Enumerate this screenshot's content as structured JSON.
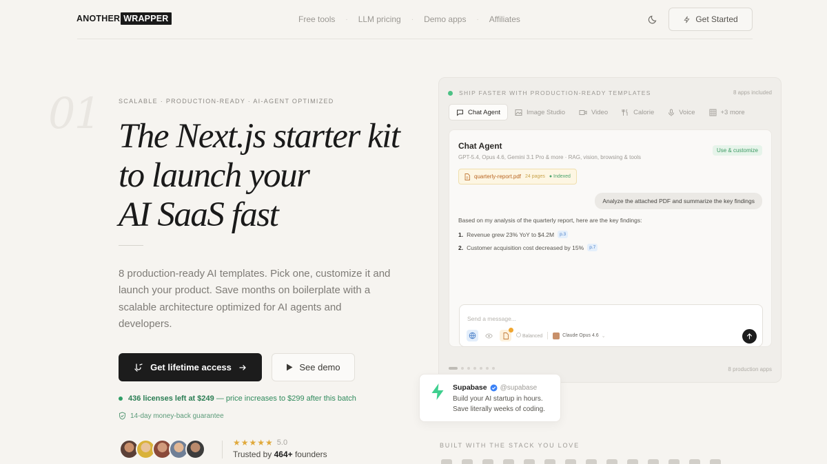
{
  "header": {
    "logo_left": "ANOTHER",
    "logo_right": "WRAPPER",
    "nav": [
      "Free tools",
      "LLM pricing",
      "Demo apps",
      "Affiliates"
    ],
    "get_started": "Get Started"
  },
  "hero": {
    "index_numeral": "01",
    "eyebrow": "SCALABLE · PRODUCTION-READY · AI-AGENT OPTIMIZED",
    "title_lines": [
      "The Next.js starter kit",
      "to launch your",
      "AI SaaS fast"
    ],
    "description": "8 production-ready AI templates. Pick one, customize it and launch your product. Save months on boilerplate with a scalable architecture optimized for AI agents and developers.",
    "primary_button": "Get lifetime access",
    "secondary_button": "See demo",
    "licenses_bold": "436 licenses left at $249",
    "licenses_rest": "— price increases to $299 after this batch",
    "guarantee": "14-day money-back guarantee",
    "stars": "★★★★★",
    "rating": "5.0",
    "trusted_prefix": "Trusted by",
    "trusted_count": "464+",
    "trusted_suffix": "founders"
  },
  "card": {
    "header": "SHIP FASTER WITH PRODUCTION-READY TEMPLATES",
    "apps_included": "8 apps included",
    "tabs": [
      "Chat Agent",
      "Image Studio",
      "Video",
      "Calorie",
      "Voice",
      "+3 more"
    ],
    "active_tab": "Chat Agent",
    "agent_title": "Chat Agent",
    "agent_subtitle": "GPT-5.4, Opus 4.6, Gemini 3.1 Pro & more · RAG, vision, browsing & tools",
    "use_badge": "Use & customize",
    "file_name": "quarterly-report.pdf",
    "file_pages": "24 pages",
    "file_status": "● Indexed",
    "user_message": "Analyze the attached PDF and summarize the key findings",
    "answer_intro": "Based on my analysis of the quarterly report, here are the key findings:",
    "findings": [
      {
        "num": "1.",
        "text": "Revenue grew 23% YoY to $4.2M",
        "ref": "p.3"
      },
      {
        "num": "2.",
        "text": "Customer acquisition cost decreased by 15%",
        "ref": "p.7"
      }
    ],
    "composer_placeholder": "Send a message...",
    "mode_label": "Balanced",
    "model_label": "Claude Opus 4.6",
    "production_apps": "8 production apps"
  },
  "tweet": {
    "name": "Supabase",
    "handle": "@supabase",
    "line1": "Build your AI startup in hours.",
    "line2": "Save literally weeks of coding."
  },
  "stack": {
    "label": "BUILT WITH THE STACK YOU LOVE"
  },
  "colors": {
    "background": "#f6f4f0",
    "primary_button": "#1c1c1c",
    "green_accent": "#2f9e66",
    "star": "#e0a93b"
  }
}
